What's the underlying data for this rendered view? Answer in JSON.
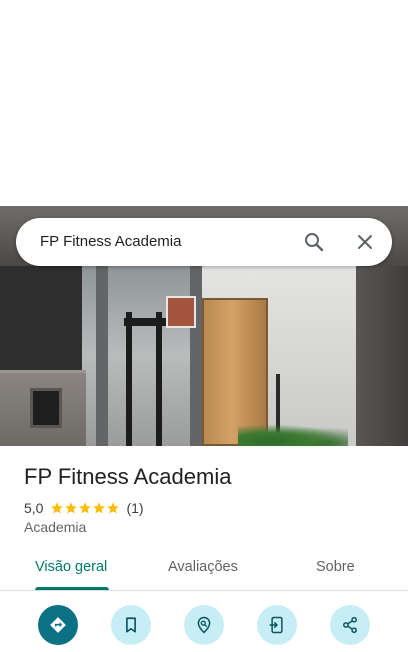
{
  "search": {
    "query": "FP Fitness Academia"
  },
  "place": {
    "name": "FP Fitness Academia",
    "rating": "5,0",
    "stars": 5,
    "review_count": "(1)",
    "category": "Academia"
  },
  "tabs": [
    {
      "label": "Visão geral",
      "active": true
    },
    {
      "label": "Avaliações",
      "active": false
    },
    {
      "label": "Sobre",
      "active": false
    }
  ],
  "actions": [
    {
      "icon": "directions-icon"
    },
    {
      "icon": "bookmark-icon"
    },
    {
      "icon": "nearby-icon"
    },
    {
      "icon": "send-to-phone-icon"
    },
    {
      "icon": "share-icon"
    }
  ],
  "colors": {
    "accent": "#00796b",
    "primary_button": "#0b7285",
    "secondary_button": "#c8eef5",
    "star": "#fbbc04"
  }
}
